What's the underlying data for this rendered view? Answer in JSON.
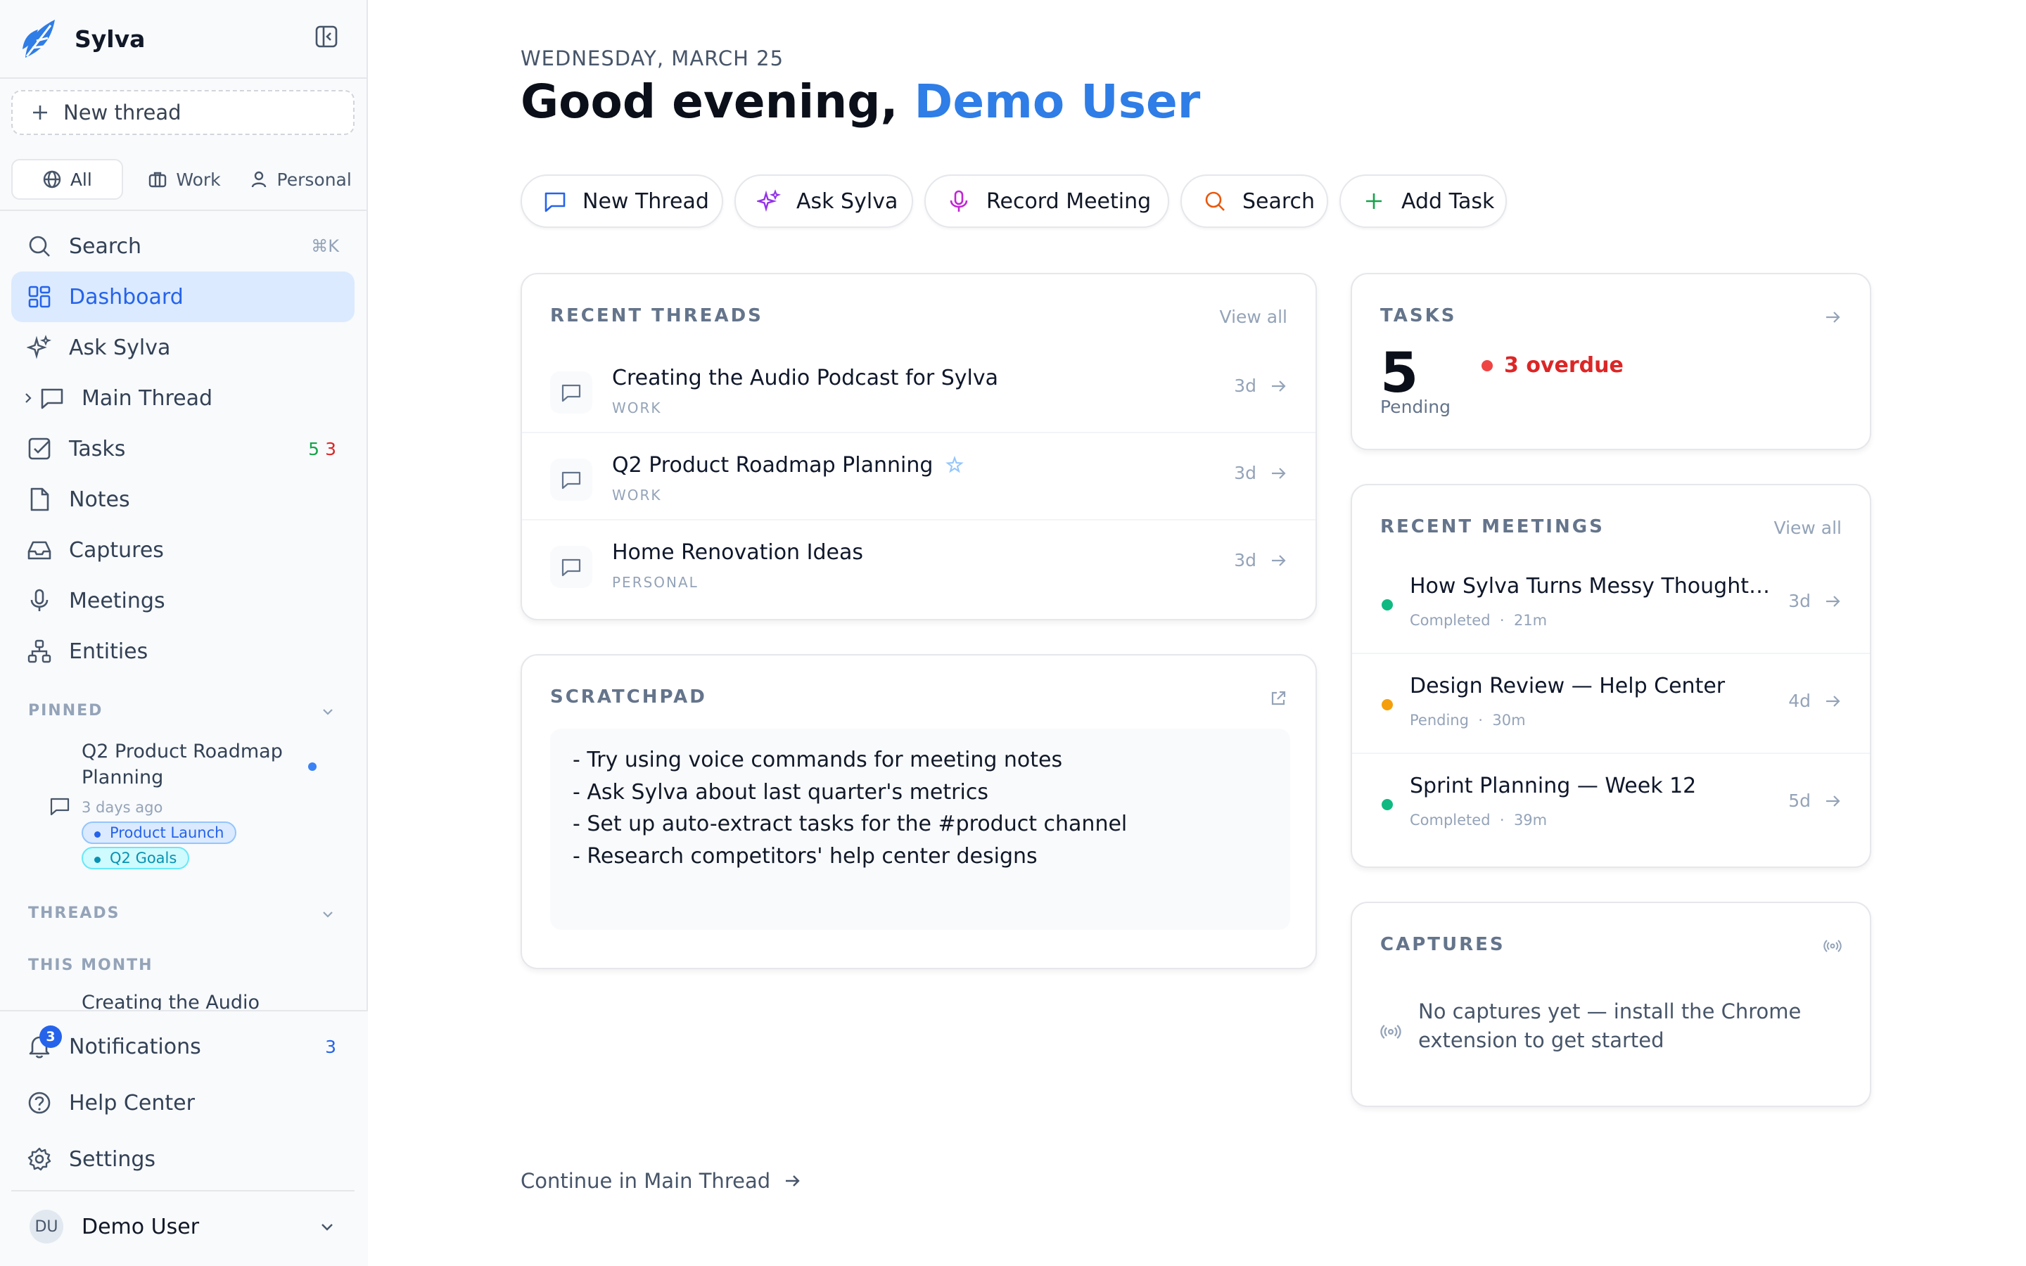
{
  "app": {
    "name": "Sylva"
  },
  "sidebar": {
    "new_thread_label": "New thread",
    "filters": [
      {
        "label": "All",
        "icon": "globe-icon",
        "active": true
      },
      {
        "label": "Work",
        "icon": "briefcase-icon"
      },
      {
        "label": "Personal",
        "icon": "user-icon"
      }
    ],
    "nav": {
      "search": {
        "label": "Search",
        "shortcut": "⌘K"
      },
      "dashboard": {
        "label": "Dashboard"
      },
      "ask": {
        "label": "Ask Sylva"
      },
      "main_thread": {
        "label": "Main Thread"
      },
      "tasks": {
        "label": "Tasks",
        "count_green": "5",
        "count_red": "3"
      },
      "notes": {
        "label": "Notes"
      },
      "captures": {
        "label": "Captures"
      },
      "meetings": {
        "label": "Meetings"
      },
      "entities": {
        "label": "Entities"
      }
    },
    "pinned": {
      "label": "PINNED",
      "item": {
        "title": "Q2 Product Roadmap Planning",
        "meta": "3 days ago",
        "tags": [
          "Product Launch",
          "Q2 Goals"
        ]
      }
    },
    "threads": {
      "label": "THREADS",
      "group_label": "THIS MONTH",
      "first_item": "Creating the Audio Podcast for Sylva"
    },
    "bottom": {
      "notifications": {
        "label": "Notifications",
        "count": "3",
        "badge": "3"
      },
      "help": {
        "label": "Help Center"
      },
      "settings": {
        "label": "Settings"
      }
    },
    "user": {
      "initials": "DU",
      "name": "Demo User"
    }
  },
  "header": {
    "date": "WEDNESDAY, MARCH 25",
    "greeting_prefix": "Good evening, ",
    "user_name": "Demo User"
  },
  "quick_actions": [
    {
      "label": "New Thread",
      "icon": "message-square-icon",
      "color": "#2563eb"
    },
    {
      "label": "Ask Sylva",
      "icon": "sparkles-icon",
      "color": "#9333ea"
    },
    {
      "label": "Record Meeting",
      "icon": "mic-icon",
      "color": "#c026d3"
    },
    {
      "label": "Search",
      "icon": "search-icon",
      "color": "#ea580c"
    },
    {
      "label": "Add Task",
      "icon": "plus-icon",
      "color": "#16a34a"
    }
  ],
  "recent_threads": {
    "title": "RECENT THREADS",
    "view_all": "View all",
    "items": [
      {
        "title": "Creating the Audio Podcast for Sylva",
        "category": "WORK",
        "age": "3d"
      },
      {
        "title": "Q2 Product Roadmap Planning",
        "category": "WORK",
        "age": "3d",
        "pinned": true
      },
      {
        "title": "Home Renovation Ideas",
        "category": "PERSONAL",
        "age": "3d"
      }
    ]
  },
  "scratchpad": {
    "title": "SCRATCHPAD",
    "lines": [
      "- Try using voice commands for meeting notes",
      "- Ask Sylva about last quarter's metrics",
      "- Set up auto-extract tasks for the #product channel",
      "- Research competitors' help center designs"
    ]
  },
  "tasks": {
    "title": "TASKS",
    "count": "5",
    "count_label": "Pending",
    "overdue": "3 overdue"
  },
  "recent_meetings": {
    "title": "RECENT MEETINGS",
    "view_all": "View all",
    "items": [
      {
        "title": "How Sylva Turns Messy Thoughts Into Action",
        "status": "Completed",
        "duration": "21m",
        "age": "3d",
        "dot_color": "#10b981"
      },
      {
        "title": "Design Review — Help Center",
        "status": "Pending",
        "duration": "30m",
        "age": "4d",
        "dot_color": "#f59e0b"
      },
      {
        "title": "Sprint Planning — Week 12",
        "status": "Completed",
        "duration": "39m",
        "age": "5d",
        "dot_color": "#10b981"
      }
    ]
  },
  "captures": {
    "title": "CAPTURES",
    "empty_message": "No captures yet — install the Chrome extension to get started"
  },
  "footer": {
    "continue_label": "Continue in Main Thread"
  }
}
